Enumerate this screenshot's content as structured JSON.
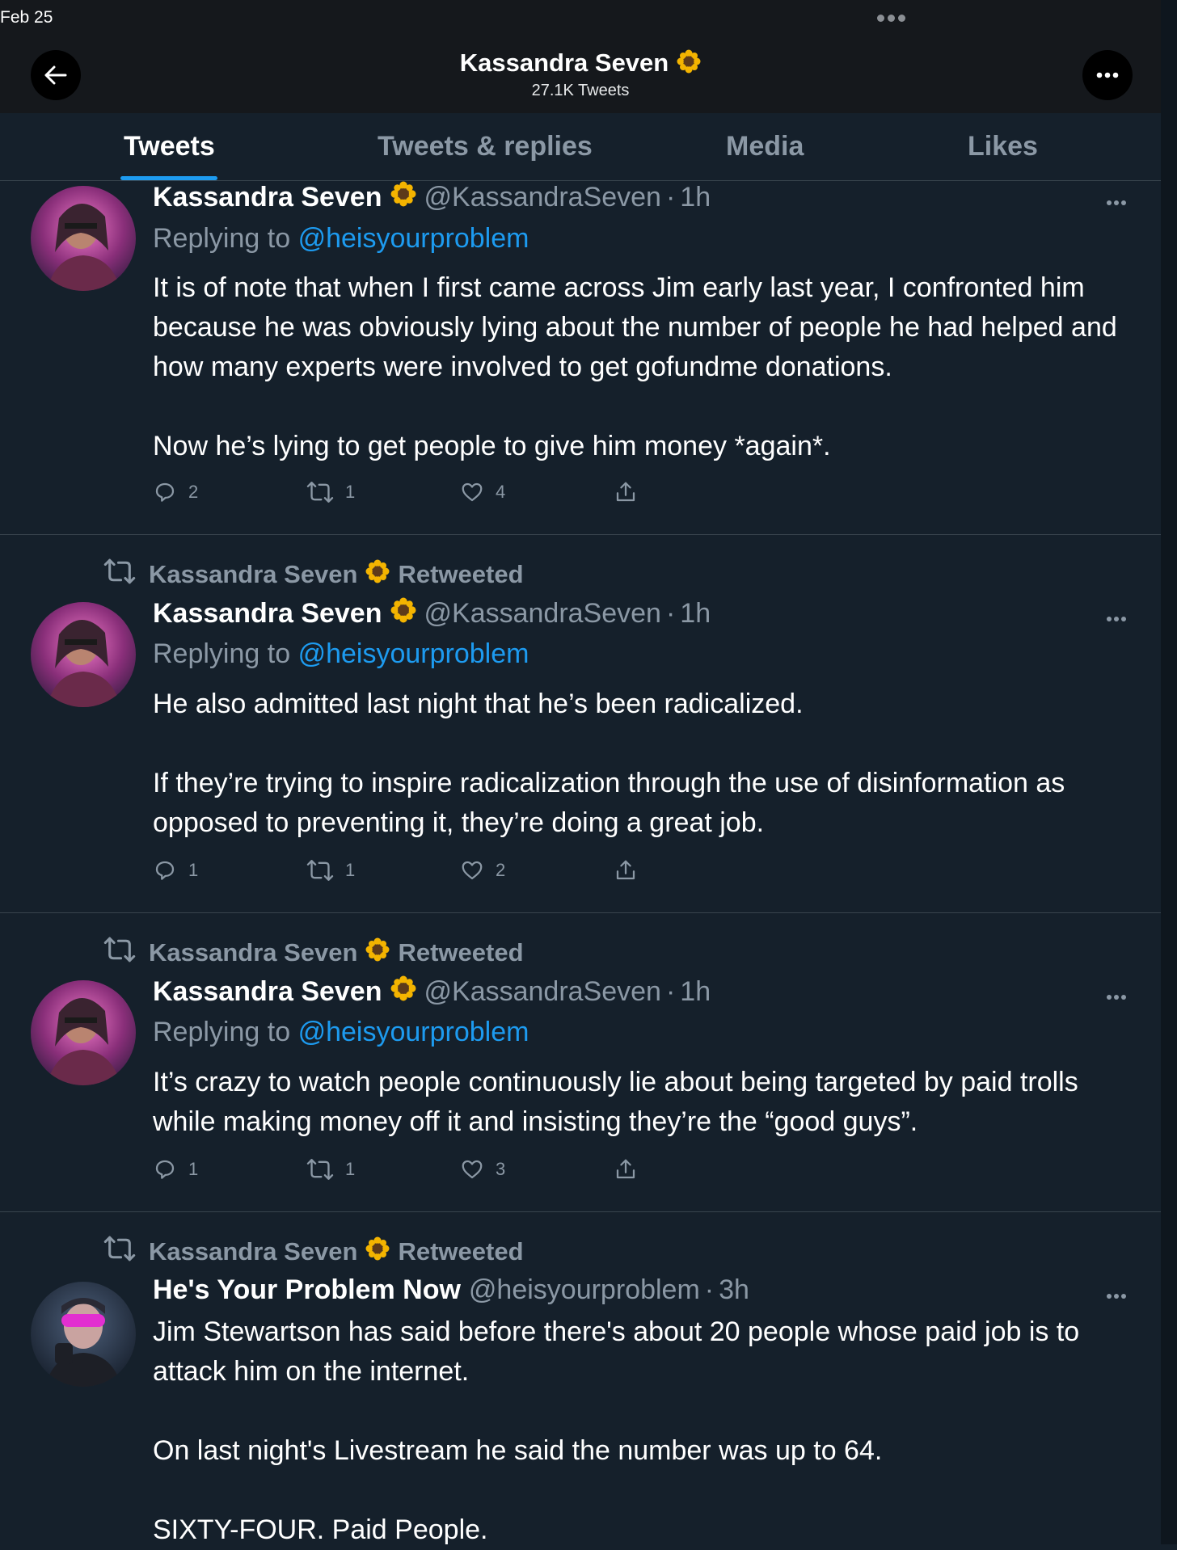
{
  "status_bar": {
    "date": "Feb 25"
  },
  "header": {
    "name": "Kassandra Seven",
    "tweet_count": "27.1K Tweets",
    "name_emoji": "sunflower-icon"
  },
  "tabs": [
    {
      "label": "Tweets",
      "active": true
    },
    {
      "label": "Tweets & replies",
      "active": false
    },
    {
      "label": "Media",
      "active": false
    },
    {
      "label": "Likes",
      "active": false
    }
  ],
  "tweets": [
    {
      "retweeted_by": null,
      "author": "Kassandra Seven",
      "handle": "@KassandraSeven",
      "time": "1h",
      "replying_prefix": "Replying to",
      "replying_to": "@heisyourproblem",
      "paragraphs": [
        "It is of note that when I first came across Jim early last year, I confronted him because he was obviously lying about the number of people he had helped and how many experts were involved to get gofundme donations.",
        "Now he’s lying to get people to give him money *again*."
      ],
      "replies": "2",
      "retweets": "1",
      "likes": "4"
    },
    {
      "retweeted_by": "Kassandra Seven",
      "retweet_suffix": "Retweeted",
      "author": "Kassandra Seven",
      "handle": "@KassandraSeven",
      "time": "1h",
      "replying_prefix": "Replying to",
      "replying_to": "@heisyourproblem",
      "paragraphs": [
        "He also admitted last night that he’s been radicalized.",
        "If they’re trying to inspire radicalization through the use of disinformation as opposed to preventing it, they’re doing a great job."
      ],
      "replies": "1",
      "retweets": "1",
      "likes": "2"
    },
    {
      "retweeted_by": "Kassandra Seven",
      "retweet_suffix": "Retweeted",
      "author": "Kassandra Seven",
      "handle": "@KassandraSeven",
      "time": "1h",
      "replying_prefix": "Replying to",
      "replying_to": "@heisyourproblem",
      "paragraphs": [
        "It’s crazy to watch people continuously  lie about being targeted by paid trolls  while making money off it and insisting they’re the “good guys”."
      ],
      "replies": "1",
      "retweets": "1",
      "likes": "3"
    },
    {
      "retweeted_by": "Kassandra Seven",
      "retweet_suffix": "Retweeted",
      "author": "He's Your Problem Now",
      "handle": "@heisyourproblem",
      "time": "3h",
      "paragraphs": [
        "Jim Stewartson has said before there's about 20 people whose paid job is to attack him on the internet.",
        "On last night's Livestream he said the number was up to 64.",
        "SIXTY-FOUR. Paid People."
      ]
    }
  ],
  "colors": {
    "background": "#15202b",
    "header_bg": "#15181c",
    "accent": "#1d9bf0",
    "muted": "#8b98a5",
    "divider": "#38444d"
  }
}
